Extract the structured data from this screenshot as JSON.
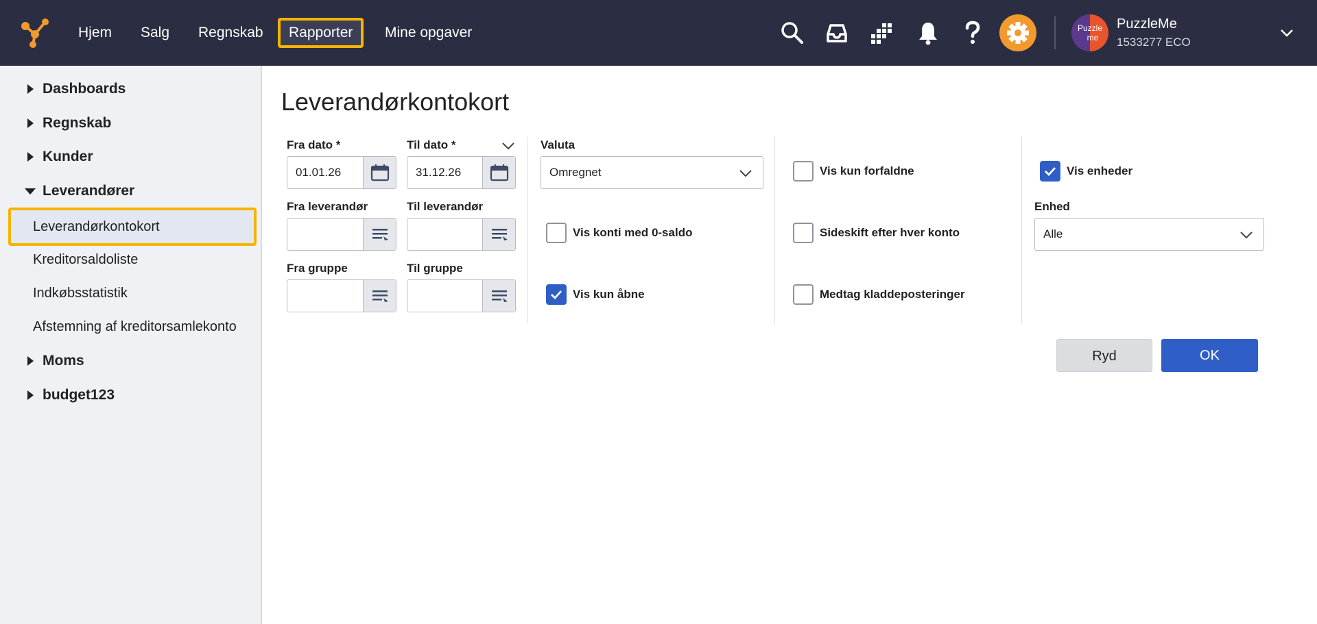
{
  "nav": {
    "items": [
      "Hjem",
      "Salg",
      "Regnskab",
      "Rapporter",
      "Mine opgaver"
    ],
    "active": "Rapporter"
  },
  "user": {
    "name": "PuzzleMe",
    "company": "1533277 ECO",
    "avatar_text_top": "Puzzle",
    "avatar_text_bottom": "me"
  },
  "icons": [
    "logo-icon",
    "search-icon",
    "inbox-icon",
    "apps-grid-icon",
    "bell-icon",
    "help-icon",
    "gear-icon",
    "chevron-down-icon"
  ],
  "sidebar": {
    "groups": {
      "dashboards": "Dashboards",
      "regnskab": "Regnskab",
      "kunder": "Kunder",
      "leverandorer": "Leverandører",
      "moms": "Moms",
      "budget": "budget123"
    },
    "leverandorer_items": [
      "Leverandørkontokort",
      "Kreditorsaldoliste",
      "Indkøbsstatistik",
      "Afstemning af kreditorsamlekonto"
    ]
  },
  "main": {
    "title": "Leverandørkontokort",
    "fra_dato_label": "Fra dato *",
    "fra_dato_value": "01.01.26",
    "til_dato_label": "Til dato *",
    "til_dato_value": "31.12.26",
    "fra_leverandor_label": "Fra leverandør",
    "til_leverandor_label": "Til leverandør",
    "fra_gruppe_label": "Fra gruppe",
    "til_gruppe_label": "Til gruppe",
    "valuta_label": "Valuta",
    "valuta_value": "Omregnet",
    "enhed_label": "Enhed",
    "enhed_value": "Alle",
    "checkboxes": {
      "vis_konti_0_saldo": {
        "label": "Vis konti med 0-saldo",
        "checked": false
      },
      "vis_kun_abne": {
        "label": "Vis kun åbne",
        "checked": true
      },
      "vis_kun_forfaldne": {
        "label": "Vis kun forfaldne",
        "checked": false
      },
      "sideskift": {
        "label": "Sideskift efter hver konto",
        "checked": false
      },
      "medtag_kladde": {
        "label": "Medtag kladdeposteringer",
        "checked": false
      },
      "vis_enheder": {
        "label": "Vis enheder",
        "checked": true
      }
    },
    "ryd_label": "Ryd",
    "ok_label": "OK"
  },
  "colors": {
    "topbar": "#2b2d42",
    "accent_highlight": "#f5b400",
    "primary": "#2f5fc6",
    "gear_bg": "#f29a2e"
  }
}
